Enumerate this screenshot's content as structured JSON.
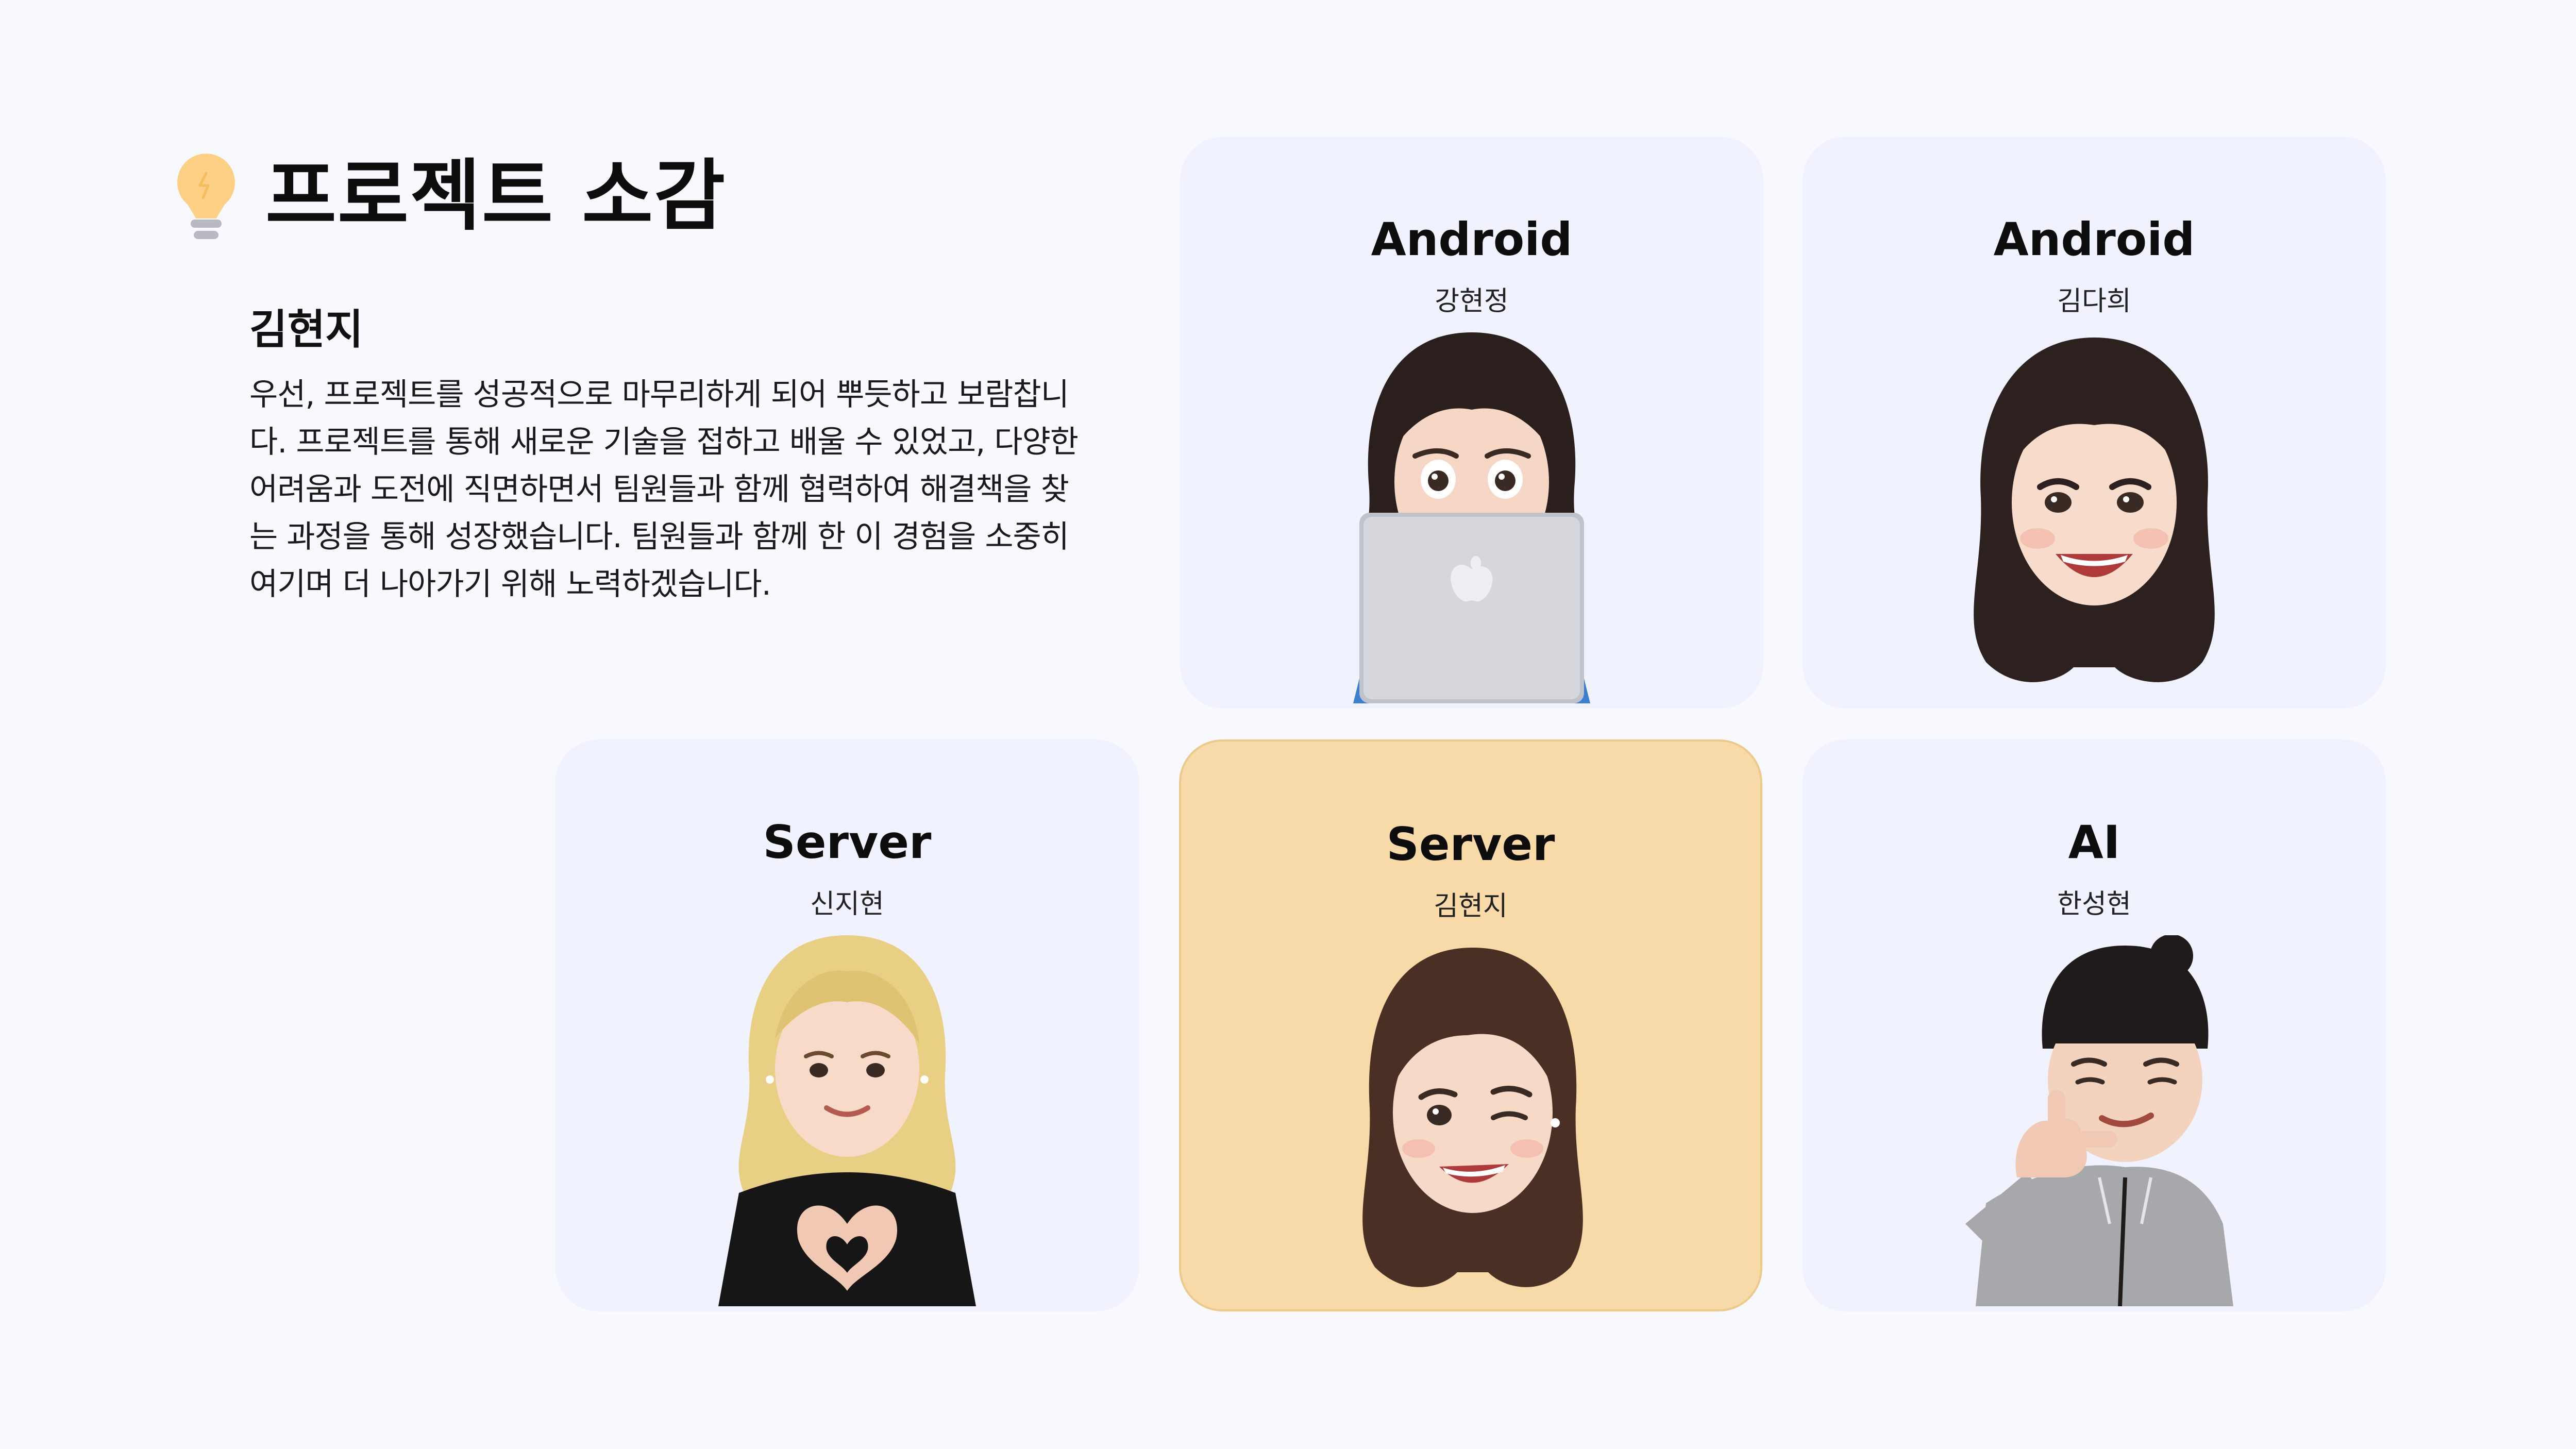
{
  "header": {
    "title": "프로젝트 소감",
    "icon": "lightbulb-icon",
    "icon_color": "#fdd085"
  },
  "reflection": {
    "name": "김현지",
    "text": "우선, 프로젝트를 성공적으로 마무리하게 되어 뿌듯하고 보람찹니다. 프로젝트를 통해 새로운 기술을 접하고 배울 수 있었고, 다양한 어려움과 도전에 직면하면서 팀원들과 함께 협력하여 해결책을 찾는 과정을 통해 성장했습니다. 팀원들과 함께 한 이 경험을 소중히 여기며 더 나아가기 위해 노력하겠습니다."
  },
  "members": [
    {
      "role": "Android",
      "name": "강현정",
      "avatar": "memoji-laptop-avatar"
    },
    {
      "role": "Android",
      "name": "김다희",
      "avatar": "memoji-smile-avatar"
    },
    {
      "role": "Server",
      "name": "신지현",
      "avatar": "memoji-heart-hands-avatar"
    },
    {
      "role": "Server",
      "name": "김현지",
      "avatar": "memoji-wink-avatar",
      "highlighted": true
    },
    {
      "role": "AI",
      "name": "한성현",
      "avatar": "memoji-call-gesture-avatar"
    }
  ],
  "colors": {
    "background": "#f8f9fe",
    "card": "#f0f3fd",
    "card_highlight": "#f8d9a8",
    "highlight_border": "#eccb8a"
  }
}
